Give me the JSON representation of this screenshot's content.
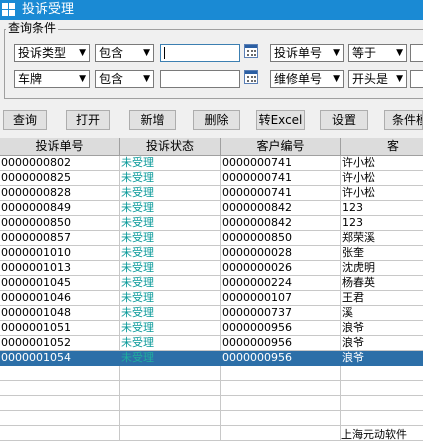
{
  "window": {
    "title": "投诉受理"
  },
  "query_group": {
    "title": "查询条件",
    "row1": {
      "field1": "投诉类型",
      "op1": "包含",
      "value1": "",
      "field2": "投诉单号",
      "op2": "等于",
      "value2": ""
    },
    "row2": {
      "field1": "车牌",
      "op1": "包含",
      "value1": "",
      "field2": "维修单号",
      "op2": "开头是",
      "value2": ""
    }
  },
  "toolbar": {
    "query": "查询",
    "open": "打开",
    "add": "新增",
    "delete": "删除",
    "export": "转Excel",
    "settings": "设置",
    "more": "条件模"
  },
  "grid": {
    "columns": [
      "投诉单号",
      "投诉状态",
      "客户编号",
      "客"
    ],
    "rows": [
      [
        "0000000802",
        "未受理",
        "0000000741",
        "许小松"
      ],
      [
        "0000000825",
        "未受理",
        "0000000741",
        "许小松"
      ],
      [
        "0000000828",
        "未受理",
        "0000000741",
        "许小松"
      ],
      [
        "0000000849",
        "未受理",
        "0000000842",
        "123"
      ],
      [
        "0000000850",
        "未受理",
        "0000000842",
        "123"
      ],
      [
        "0000000857",
        "未受理",
        "0000000850",
        "郑荣溪"
      ],
      [
        "0000001010",
        "未受理",
        "0000000028",
        "张奎"
      ],
      [
        "0000001013",
        "未受理",
        "0000000026",
        "沈虎明"
      ],
      [
        "0000001045",
        "未受理",
        "0000000224",
        "杨春英"
      ],
      [
        "0000001046",
        "未受理",
        "0000000107",
        "王君"
      ],
      [
        "0000001048",
        "未受理",
        "0000000737",
        "溪"
      ],
      [
        "0000001051",
        "未受理",
        "0000000956",
        "浪爷"
      ],
      [
        "0000001052",
        "未受理",
        "0000000956",
        "浪爷"
      ],
      [
        "0000001054",
        "未受理",
        "0000000956",
        "浪爷"
      ]
    ],
    "selected_row": 13
  },
  "footer": {
    "company": "上海元动软件"
  },
  "colors": {
    "titlebar": "#1a8ad4",
    "status_text": "#0a9a9a",
    "selection": "#2c6fa8"
  }
}
